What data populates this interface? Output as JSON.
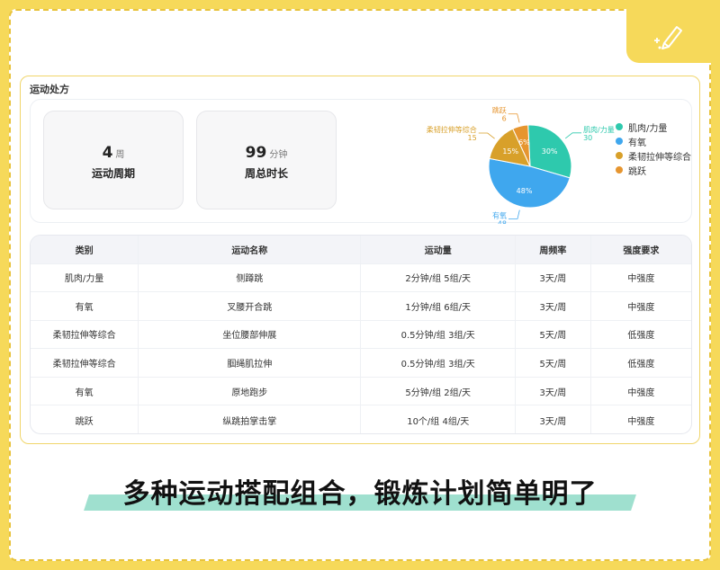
{
  "panel": {
    "title": "运动处方"
  },
  "stats": [
    {
      "value": "4",
      "unit": "周",
      "label": "运动周期"
    },
    {
      "value": "99",
      "unit": "分钟",
      "label": "周总时长"
    }
  ],
  "chart_data": {
    "type": "pie",
    "categories": [
      "肌肉/力量",
      "有氧",
      "柔韧拉伸等综合",
      "跳跃"
    ],
    "values": [
      30,
      48,
      15,
      6
    ],
    "percent_labels": [
      "30%",
      "48%",
      "15%",
      "6%"
    ],
    "colors": [
      "#2ec9ad",
      "#3fa7ee",
      "#d8a02a",
      "#e6952f"
    ],
    "legend_position": "right"
  },
  "table": {
    "headers": [
      "类别",
      "运动名称",
      "运动量",
      "周频率",
      "强度要求"
    ],
    "rows": [
      [
        "肌肉/力量",
        "侧蹲跳",
        "2分钟/组 5组/天",
        "3天/周",
        "中强度"
      ],
      [
        "有氧",
        "叉腰开合跳",
        "1分钟/组 6组/天",
        "3天/周",
        "中强度"
      ],
      [
        "柔韧拉伸等综合",
        "坐位腰部伸展",
        "0.5分钟/组 3组/天",
        "5天/周",
        "低强度"
      ],
      [
        "柔韧拉伸等综合",
        "腘绳肌拉伸",
        "0.5分钟/组 3组/天",
        "5天/周",
        "低强度"
      ],
      [
        "有氧",
        "原地跑步",
        "5分钟/组 2组/天",
        "3天/周",
        "中强度"
      ],
      [
        "跳跃",
        "纵跳拍掌击掌",
        "10个/组 4组/天",
        "3天/周",
        "中强度"
      ]
    ]
  },
  "banner": {
    "text": "多种运动搭配组合，锻炼计划简单明了"
  },
  "icons": {
    "corner": "pen-sparkle-icon"
  }
}
